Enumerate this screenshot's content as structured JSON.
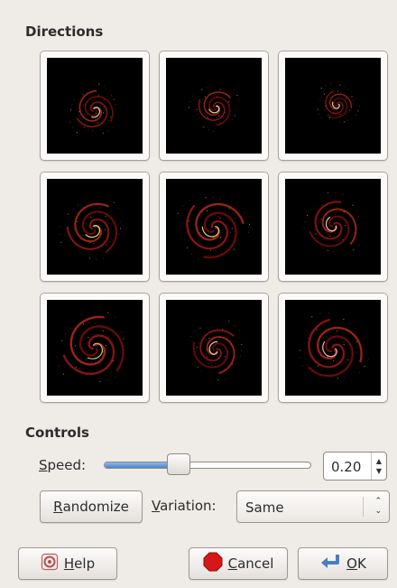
{
  "directions": {
    "title": "Directions"
  },
  "thumbnails": [
    "preview-1",
    "preview-2",
    "preview-3",
    "preview-4",
    "preview-5",
    "preview-6",
    "preview-7",
    "preview-8",
    "preview-9"
  ],
  "controls": {
    "title": "Controls"
  },
  "speed": {
    "label_underlined": "S",
    "label_rest": "peed:",
    "value": "0.20",
    "level_fraction": 0.36
  },
  "randomize": {
    "label_underlined": "R",
    "label_rest": "andomize"
  },
  "variation": {
    "label_underlined": "V",
    "label_rest": "ariation:",
    "selected": "Same"
  },
  "footer": {
    "help_underlined": "H",
    "help_rest": "elp",
    "cancel_underlined": "C",
    "cancel_rest": "ancel",
    "ok_underlined": "O",
    "ok_rest": "K"
  },
  "colors": {
    "accent": "#4a86c8",
    "cancel_red": "#d7161b",
    "background": "#efebe7"
  },
  "icons": {
    "help": "help-icon",
    "cancel": "stop-icon",
    "ok": "ok-arrow-icon"
  }
}
